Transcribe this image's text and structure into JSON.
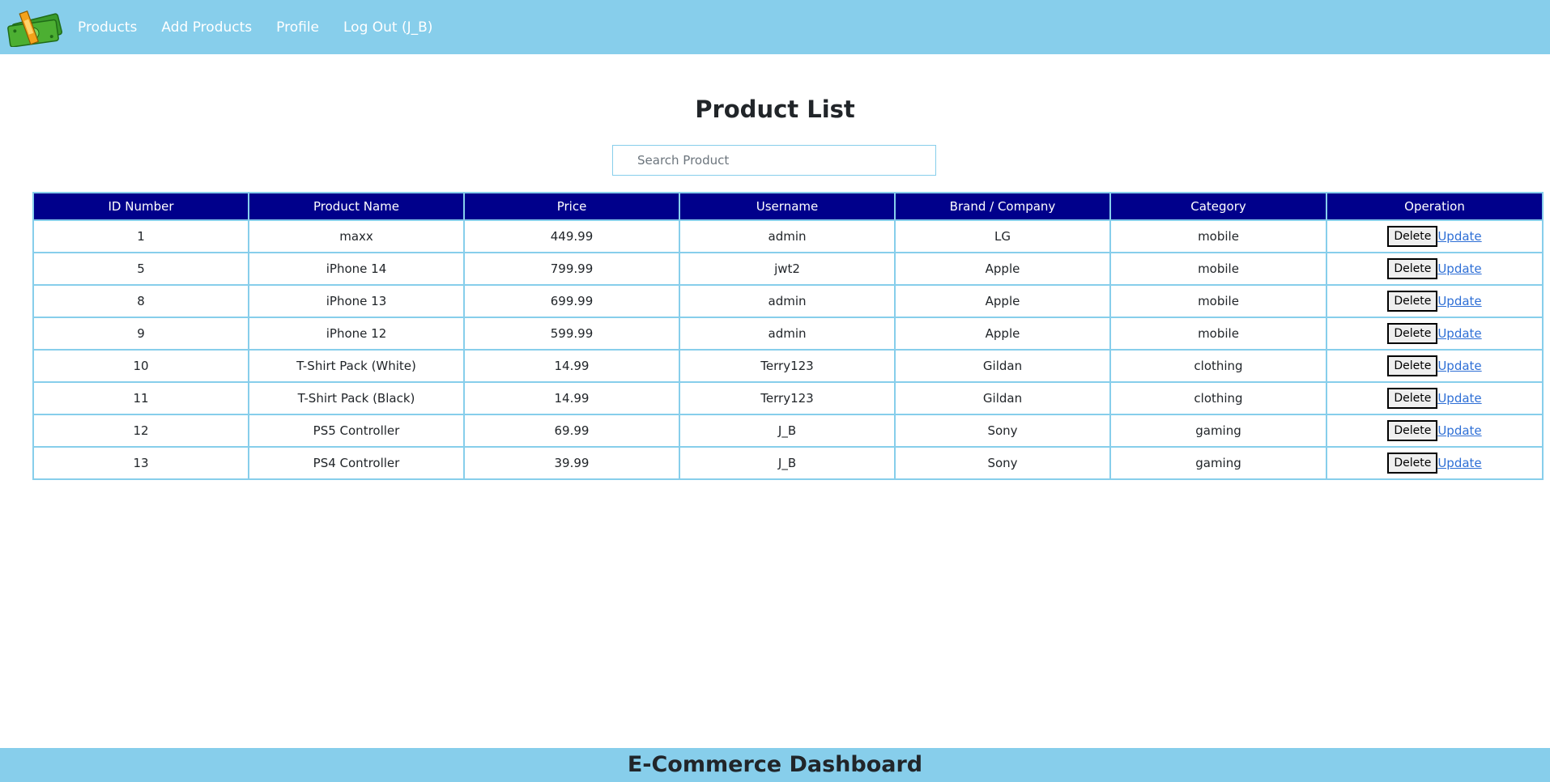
{
  "nav": {
    "links": [
      {
        "label": "Products"
      },
      {
        "label": "Add Products"
      },
      {
        "label": "Profile"
      },
      {
        "label": "Log Out (J_B)"
      }
    ]
  },
  "main": {
    "title": "Product List",
    "search": {
      "placeholder": "Search Product",
      "value": ""
    }
  },
  "table": {
    "headers": [
      "ID Number",
      "Product Name",
      "Price",
      "Username",
      "Brand / Company",
      "Category",
      "Operation"
    ],
    "delete_label": "Delete",
    "update_label": "Update",
    "rows": [
      {
        "id": "1",
        "name": "maxx",
        "price": "449.99",
        "username": "admin",
        "brand": "LG",
        "category": "mobile"
      },
      {
        "id": "5",
        "name": "iPhone 14",
        "price": "799.99",
        "username": "jwt2",
        "brand": "Apple",
        "category": "mobile"
      },
      {
        "id": "8",
        "name": "iPhone 13",
        "price": "699.99",
        "username": "admin",
        "brand": "Apple",
        "category": "mobile"
      },
      {
        "id": "9",
        "name": "iPhone 12",
        "price": "599.99",
        "username": "admin",
        "brand": "Apple",
        "category": "mobile"
      },
      {
        "id": "10",
        "name": "T-Shirt Pack (White)",
        "price": "14.99",
        "username": "Terry123",
        "brand": "Gildan",
        "category": "clothing"
      },
      {
        "id": "11",
        "name": "T-Shirt Pack (Black)",
        "price": "14.99",
        "username": "Terry123",
        "brand": "Gildan",
        "category": "clothing"
      },
      {
        "id": "12",
        "name": "PS5 Controller",
        "price": "69.99",
        "username": "J_B",
        "brand": "Sony",
        "category": "gaming"
      },
      {
        "id": "13",
        "name": "PS4 Controller",
        "price": "39.99",
        "username": "J_B",
        "brand": "Sony",
        "category": "gaming"
      }
    ]
  },
  "footer": {
    "title": "E-Commerce Dashboard"
  },
  "colors": {
    "nav_bg": "#87ceeb",
    "table_header_bg": "#00008b",
    "table_border": "#87ceeb",
    "link": "#2e6fd6"
  },
  "icons": {
    "logo": "money-stack-logo-icon"
  }
}
